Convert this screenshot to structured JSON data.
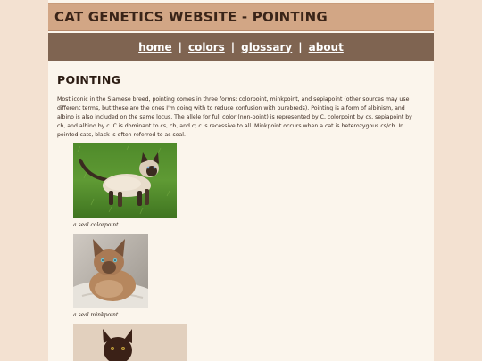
{
  "header": {
    "title": "CAT GENETICS WEBSITE - POINTING"
  },
  "nav": {
    "items": [
      {
        "label": "home"
      },
      {
        "label": "colors"
      },
      {
        "label": "glossary"
      },
      {
        "label": "about"
      }
    ],
    "separator": "|"
  },
  "main": {
    "heading": "POINTING",
    "intro": "Most iconic in the Siamese breed, pointing comes in three forms: colorpoint, minkpoint, and sepiapoint (other sources may use different terms, but these are the ones I'm going with to reduce confusion with purebreds). Pointing is a form of albinism, and albino is also included on the same locus. The allele for full color (non-point) is represented by C, colorpoint by cs, sepiapoint by cb, and albino by c. C is dominant to cs, cb, and c; c is recessive to all. Minkpoint occurs when a cat is heterozygous cs/cb. In pointed cats, black is often referred to as seal.",
    "figures": [
      {
        "caption": "a seal colorpoint.",
        "photo": "siamese-cat-on-grass"
      },
      {
        "caption": "a seal minkpoint.",
        "photo": "tonkinese-cat-on-blanket"
      },
      {
        "caption": "",
        "photo": "dark-brown-cat"
      }
    ]
  },
  "colors": {
    "background": "#f3e1d1",
    "page": "#fbf5ec",
    "header": "#d2a685",
    "nav": "#7f6451"
  }
}
